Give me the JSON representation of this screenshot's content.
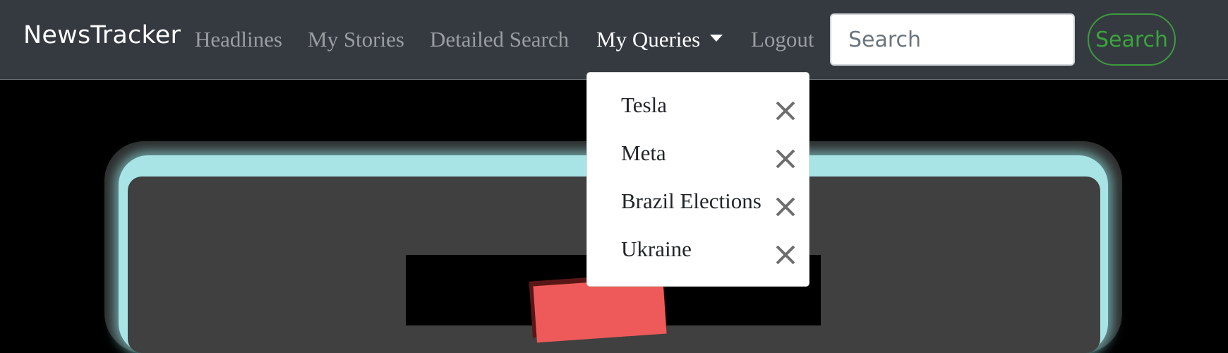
{
  "navbar": {
    "brand": "NewsTracker",
    "links": [
      {
        "label": "Headlines"
      },
      {
        "label": "My Stories"
      },
      {
        "label": "Detailed Search"
      },
      {
        "label": "My Queries"
      },
      {
        "label": "Logout"
      }
    ],
    "search": {
      "placeholder": "Search",
      "value": ""
    },
    "search_button_label": "Search"
  },
  "queries_menu": {
    "items": [
      {
        "label": "Tesla",
        "remove_icon": "close-icon"
      },
      {
        "label": "Meta",
        "remove_icon": "close-icon"
      },
      {
        "label": "Brazil Elections",
        "remove_icon": "close-icon"
      },
      {
        "label": "Ukraine",
        "remove_icon": "close-icon"
      }
    ]
  },
  "colors": {
    "navbar_bg": "#343a40",
    "link_inactive": "#9a9da1",
    "link_active": "#ffffff",
    "search_button": "#3aa53a",
    "glow": "#a8e4e6",
    "card_bg": "#404040",
    "accent_shape": "#ee5a59"
  }
}
